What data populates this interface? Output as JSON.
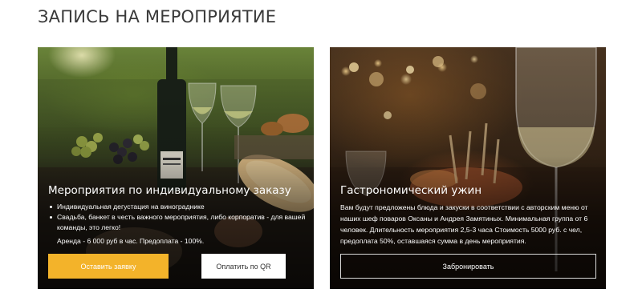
{
  "section": {
    "title": "ЗАПИСЬ НА МЕРОПРИЯТИЕ"
  },
  "cards": [
    {
      "title": "Мероприятия по индивидуальному заказу",
      "bullets": [
        "Индивидуальная дегустация на винограднике",
        "Свадьба, банкет в честь важного мероприятия, либо корпоратив - для вашей команды, это легко!"
      ],
      "rent": "Аренда - 6 000 руб в час. Предоплата - 100%.",
      "primary_button": "Оставить заявку",
      "secondary_button": "Оплатить по QR"
    },
    {
      "title": "Гастрономический ужин",
      "description": "Вам будут предложены блюда и закуски в соответствии с авторским меню от наших шеф поваров Оксаны и Андрея Замятиных. Минимальная группа от 6 человек.  Длительность мероприятия 2,5-3 часа Стоимость 5000 руб. с чел, предоплата 50%, оставшаяся сумма в день мероприятия.",
      "button": "Забронировать"
    }
  ],
  "colors": {
    "accent": "#f3b32a",
    "title": "#3a3a3a"
  }
}
